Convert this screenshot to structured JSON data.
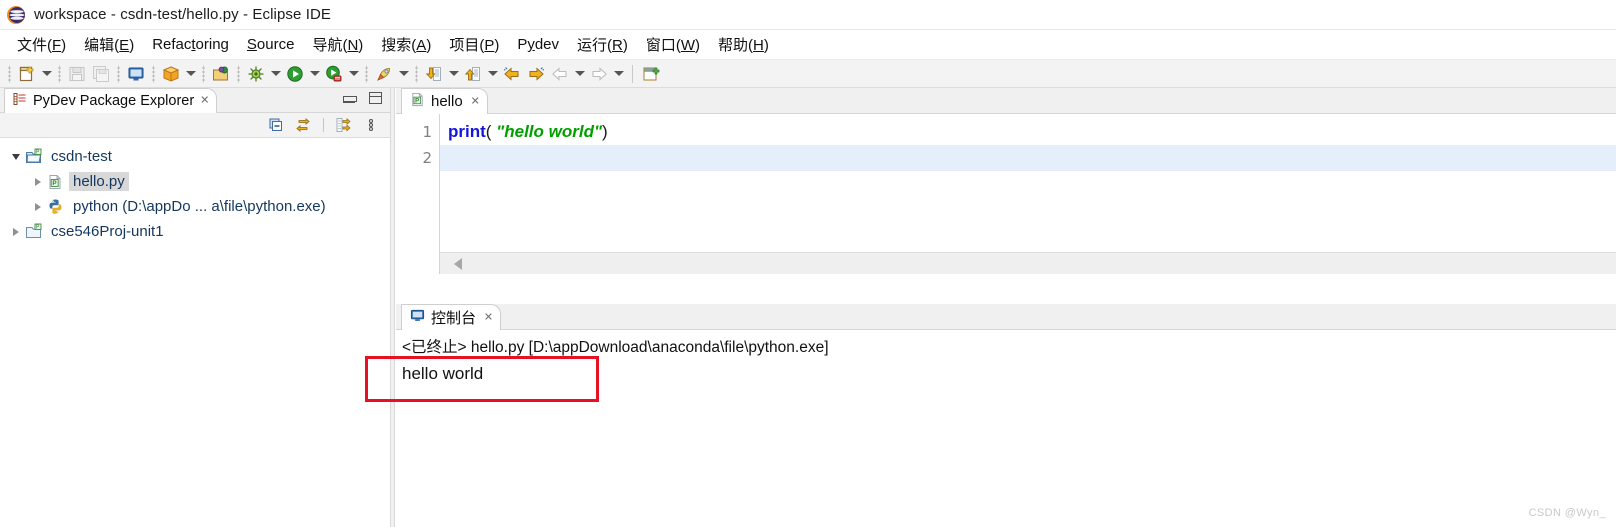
{
  "window": {
    "title": "workspace - csdn-test/hello.py - Eclipse IDE",
    "logo_icon": "eclipse-logo-icon"
  },
  "menubar": {
    "items": [
      {
        "label": "文件(F)",
        "mnemonic": "F"
      },
      {
        "label": "编辑(E)",
        "mnemonic": "E"
      },
      {
        "label": "Refactoring",
        "mnemonic": "t"
      },
      {
        "label": "Source",
        "mnemonic": "S"
      },
      {
        "label": "导航(N)",
        "mnemonic": "N"
      },
      {
        "label": "搜索(A)",
        "mnemonic": "A"
      },
      {
        "label": "项目(P)",
        "mnemonic": "P"
      },
      {
        "label": "Pydev",
        "mnemonic": "y"
      },
      {
        "label": "运行(R)",
        "mnemonic": "R"
      },
      {
        "label": "窗口(W)",
        "mnemonic": "W"
      },
      {
        "label": "帮助(H)",
        "mnemonic": "H"
      }
    ]
  },
  "toolbar": {
    "buttons": [
      {
        "icon": "new-wizard-icon",
        "enabled": true,
        "dropdown": true
      },
      {
        "icon": "save-icon",
        "enabled": false,
        "dropdown": false
      },
      {
        "icon": "save-all-icon",
        "enabled": false,
        "dropdown": false
      },
      {
        "icon": "console-monitor-icon",
        "enabled": true,
        "dropdown": false
      },
      {
        "icon": "package-box-icon",
        "enabled": true,
        "dropdown": true
      },
      {
        "icon": "open-package-icon",
        "enabled": true,
        "dropdown": false
      },
      {
        "icon": "debug-bug-icon",
        "enabled": true,
        "dropdown": true
      },
      {
        "icon": "run-play-icon",
        "enabled": true,
        "dropdown": true
      },
      {
        "icon": "run-coverage-icon",
        "enabled": true,
        "dropdown": true
      },
      {
        "icon": "pydev-rocket-icon",
        "enabled": true,
        "dropdown": true
      },
      {
        "icon": "next-annotation-icon",
        "enabled": true,
        "dropdown": true
      },
      {
        "icon": "previous-annotation-icon",
        "enabled": true,
        "dropdown": true
      },
      {
        "icon": "back-history-icon",
        "enabled": true,
        "dropdown": false
      },
      {
        "icon": "forward-history-icon",
        "enabled": true,
        "dropdown": false
      },
      {
        "icon": "back-nav-icon",
        "enabled": false,
        "dropdown": true
      },
      {
        "icon": "forward-nav-icon",
        "enabled": false,
        "dropdown": true
      },
      {
        "icon": "open-perspective-icon",
        "enabled": true,
        "dropdown": false
      }
    ]
  },
  "explorer": {
    "tab": {
      "label": "PyDev Package Explorer",
      "icon": "pydev-package-explorer-icon",
      "close_icon": "close-icon"
    },
    "window_buttons": {
      "minimize_icon": "minimize-icon",
      "maximize_icon": "maximize-icon"
    },
    "view_toolbar": [
      {
        "icon": "collapse-all-icon"
      },
      {
        "icon": "link-with-editor-icon"
      },
      {
        "icon": "focus-active-task-icon"
      },
      {
        "icon": "view-menu-icon"
      }
    ],
    "tree": [
      {
        "label": "csdn-test",
        "icon": "pydev-project-icon",
        "indent": 0,
        "twisty": "open",
        "selected": false
      },
      {
        "label": "hello.py",
        "icon": "python-file-icon",
        "indent": 1,
        "twisty": "closed",
        "selected": true
      },
      {
        "label": "python  (D:\\appDo ... a\\file\\python.exe)",
        "icon": "python-interpreter-icon",
        "indent": 1,
        "twisty": "closed",
        "selected": false
      },
      {
        "label": "cse546Proj-unit1",
        "icon": "pydev-project-closed-icon",
        "indent": 0,
        "twisty": "closed",
        "selected": false
      }
    ]
  },
  "editor": {
    "tab": {
      "label": "hello",
      "icon": "python-file-icon",
      "close_icon": "close-icon"
    },
    "lines": [
      {
        "number": "1",
        "current": false,
        "tokens": [
          {
            "text": "print",
            "type": "fn"
          },
          {
            "text": "( ",
            "type": "punc"
          },
          {
            "text": "\"hello world\"",
            "type": "str"
          },
          {
            "text": ")",
            "type": "punc"
          }
        ]
      },
      {
        "number": "2",
        "current": true,
        "tokens": []
      }
    ],
    "hscroll": {
      "left_arrow_icon": "scroll-left-arrow-icon"
    }
  },
  "console": {
    "tab": {
      "label": "控制台",
      "icon": "console-monitor-icon",
      "close_icon": "close-icon"
    },
    "status_line": "<已终止> hello.py [D:\\appDownload\\anaconda\\file\\python.exe]",
    "output_line": "hello world"
  },
  "annotation": {
    "red_box_color": "#e81123"
  },
  "watermark": {
    "text": "CSDN @Wyn_"
  }
}
